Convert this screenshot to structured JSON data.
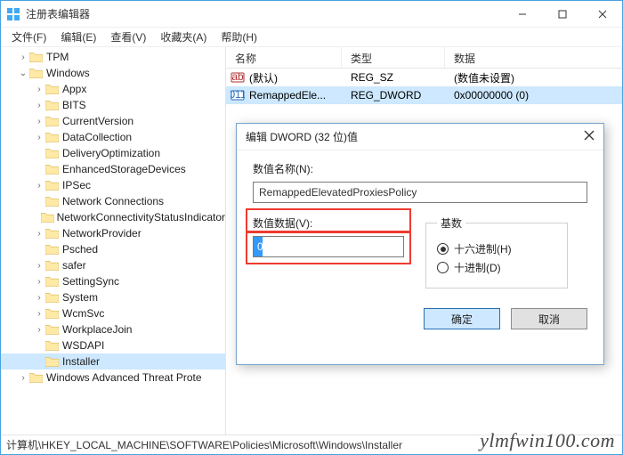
{
  "window": {
    "title": "注册表编辑器",
    "watermark": "ylmfwin100.com"
  },
  "menu": {
    "file": "文件(F)",
    "edit": "编辑(E)",
    "view": "查看(V)",
    "favorites": "收藏夹(A)",
    "help": "帮助(H)"
  },
  "tree": {
    "items": [
      {
        "indent": 1,
        "tw": ">",
        "label": "TPM"
      },
      {
        "indent": 1,
        "tw": "v",
        "label": "Windows"
      },
      {
        "indent": 2,
        "tw": ">",
        "label": "Appx"
      },
      {
        "indent": 2,
        "tw": ">",
        "label": "BITS"
      },
      {
        "indent": 2,
        "tw": ">",
        "label": "CurrentVersion"
      },
      {
        "indent": 2,
        "tw": ">",
        "label": "DataCollection"
      },
      {
        "indent": 2,
        "tw": "",
        "label": "DeliveryOptimization"
      },
      {
        "indent": 2,
        "tw": "",
        "label": "EnhancedStorageDevices"
      },
      {
        "indent": 2,
        "tw": ">",
        "label": "IPSec"
      },
      {
        "indent": 2,
        "tw": "",
        "label": "Network Connections"
      },
      {
        "indent": 2,
        "tw": "",
        "label": "NetworkConnectivityStatusIndicator"
      },
      {
        "indent": 2,
        "tw": ">",
        "label": "NetworkProvider"
      },
      {
        "indent": 2,
        "tw": "",
        "label": "Psched"
      },
      {
        "indent": 2,
        "tw": ">",
        "label": "safer"
      },
      {
        "indent": 2,
        "tw": ">",
        "label": "SettingSync"
      },
      {
        "indent": 2,
        "tw": ">",
        "label": "System"
      },
      {
        "indent": 2,
        "tw": ">",
        "label": "WcmSvc"
      },
      {
        "indent": 2,
        "tw": ">",
        "label": "WorkplaceJoin"
      },
      {
        "indent": 2,
        "tw": "",
        "label": "WSDAPI"
      },
      {
        "indent": 2,
        "tw": "",
        "label": "Installer",
        "selected": true
      },
      {
        "indent": 1,
        "tw": ">",
        "label": "Windows Advanced Threat Prote"
      }
    ]
  },
  "list": {
    "headers": {
      "name": "名称",
      "type": "类型",
      "data": "数据"
    },
    "rows": [
      {
        "icon": "sz",
        "name": "(默认)",
        "type": "REG_SZ",
        "data": "(数值未设置)"
      },
      {
        "icon": "dw",
        "name": "RemappedEle...",
        "type": "REG_DWORD",
        "data": "0x00000000 (0)",
        "selected": true
      }
    ]
  },
  "dialog": {
    "title": "编辑 DWORD (32 位)值",
    "name_label": "数值名称(N):",
    "name_value": "RemappedElevatedProxiesPolicy",
    "data_label": "数值数据(V):",
    "data_value": "0",
    "base_label": "基数",
    "radio_hex": "十六进制(H)",
    "radio_dec": "十进制(D)",
    "ok": "确定",
    "cancel": "取消"
  },
  "statusbar": {
    "path": "计算机\\HKEY_LOCAL_MACHINE\\SOFTWARE\\Policies\\Microsoft\\Windows\\Installer"
  }
}
